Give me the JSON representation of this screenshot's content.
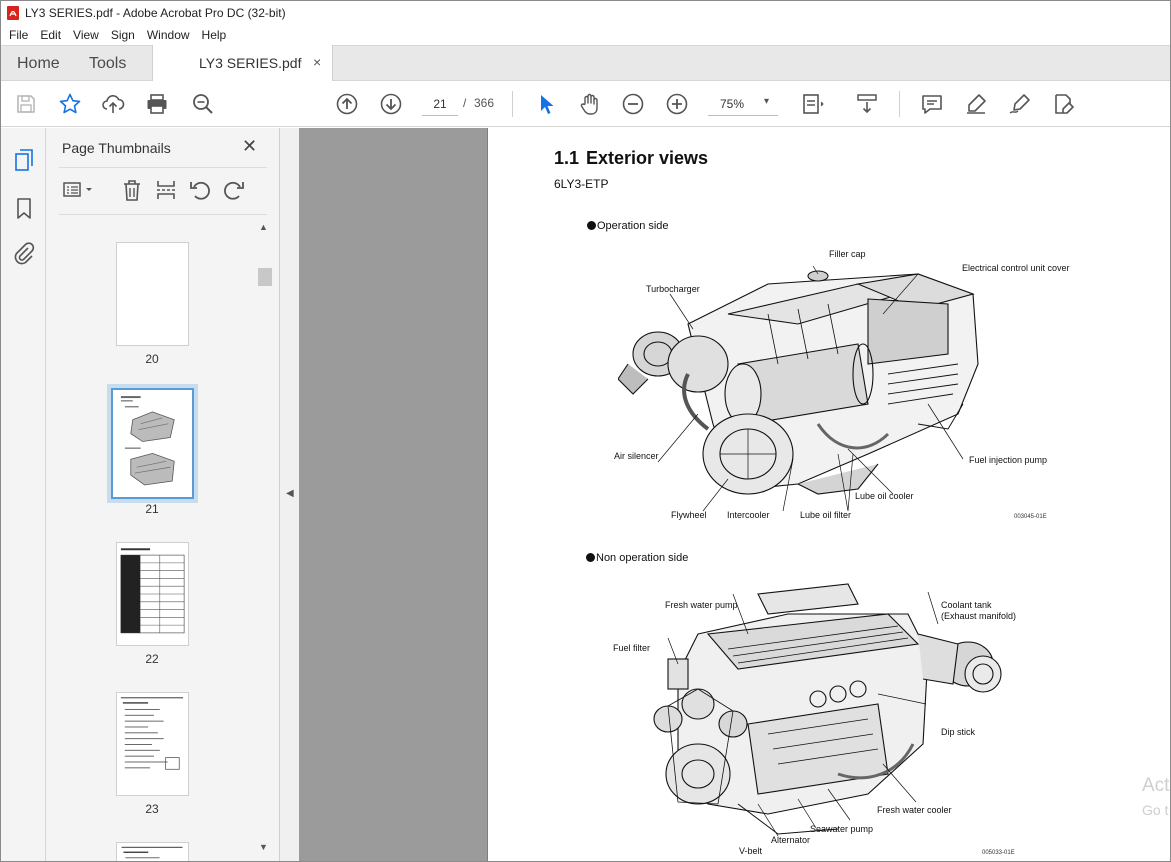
{
  "window": {
    "title": "LY3 SERIES.pdf - Adobe Acrobat Pro DC (32-bit)"
  },
  "menu": [
    "File",
    "Edit",
    "View",
    "Sign",
    "Window",
    "Help"
  ],
  "tabs": {
    "home": "Home",
    "tools": "Tools",
    "document": "LY3 SERIES.pdf",
    "close_symbol": "×"
  },
  "toolbar": {
    "current_page": "21",
    "page_sep": "/",
    "total_pages": "366",
    "zoom": "75%",
    "zoom_caret": "▾"
  },
  "icons": {
    "toolbar": [
      "save-icon",
      "star-icon",
      "upload-icon",
      "print-icon",
      "search-zoom-icon",
      "page-up-icon",
      "page-down-icon",
      "zoom-out-icon",
      "zoom-in-icon",
      "select-cursor-icon",
      "hand-icon",
      "page-fit-icon",
      "scroll-mode-icon",
      "comment-icon",
      "highlight-icon",
      "sign-icon",
      "edit-pdf-icon"
    ],
    "rail": [
      "page-thumbnails-icon",
      "bookmark-icon",
      "attachment-icon"
    ]
  },
  "colors": {
    "accent": "#1473e6",
    "selected_thumb": "#5b9bd5",
    "viewport_bg": "#9b9b9b"
  },
  "thumbnails_panel": {
    "title": "Page Thumbnails",
    "close_symbol": "✕",
    "pages": [
      {
        "number": "20"
      },
      {
        "number": "21",
        "selected": true
      },
      {
        "number": "22"
      },
      {
        "number": "23"
      }
    ],
    "scroll_up": "▲",
    "scroll_down": "▼"
  },
  "splitter": {
    "arrow": "◀"
  },
  "document": {
    "section_number": "1.1",
    "section_title": "Exterior views",
    "model": "6LY3-ETP",
    "operation_side": {
      "label": "Operation side",
      "callouts": {
        "filler_cap": "Filler cap",
        "electrical_control_unit_cover": "Electrical control unit cover",
        "turbocharger": "Turbocharger",
        "air_silencer": "Air silencer",
        "fuel_injection_pump": "Fuel injection pump",
        "lube_oil_cooler": "Lube oil cooler",
        "flywheel": "Flywheel",
        "intercooler": "Intercooler",
        "lube_oil_filter": "Lube oil filter"
      },
      "figure_code": "003045-01E"
    },
    "non_operation_side": {
      "label": "Non operation side",
      "callouts": {
        "fresh_water_pump": "Fresh water pump",
        "coolant_tank": "Coolant tank",
        "exhaust_manifold": "(Exhaust manifold)",
        "fuel_filter": "Fuel filter",
        "dip_stick": "Dip stick",
        "fresh_water_cooler": "Fresh water cooler",
        "seawater_pump": "Seawater pump",
        "alternator": "Alternator",
        "v_belt": "V-belt"
      },
      "figure_code": "005033-01E"
    }
  },
  "overlay": {
    "activate_line1": "Act",
    "activate_line2": "Go t"
  }
}
